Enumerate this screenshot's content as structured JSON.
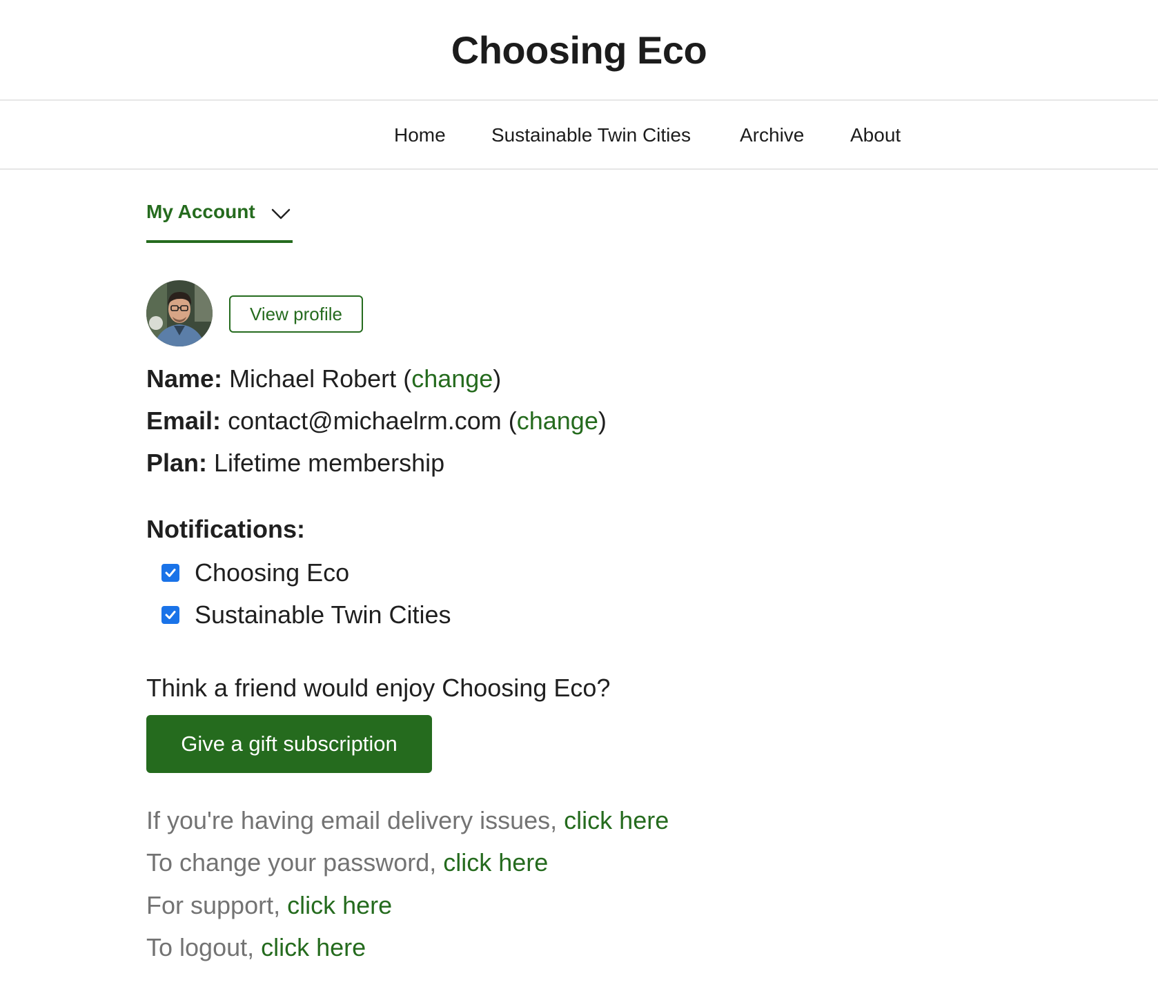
{
  "site": {
    "title": "Choosing Eco"
  },
  "nav": {
    "items": [
      {
        "label": "Home"
      },
      {
        "label": "Sustainable Twin Cities"
      },
      {
        "label": "Archive"
      },
      {
        "label": "About"
      }
    ]
  },
  "account_menu": {
    "label": "My Account",
    "icon": "chevron-down-icon"
  },
  "profile": {
    "avatar": "avatar-photo",
    "view_profile_label": "View profile"
  },
  "account_info": {
    "name_label": "Name:",
    "name_value": "Michael Robert",
    "email_label": "Email:",
    "email_value": "contact@michaelrm.com",
    "change_label": "change",
    "plan_label": "Plan:",
    "plan_value": "Lifetime membership"
  },
  "notifications": {
    "heading": "Notifications:",
    "items": [
      {
        "label": "Choosing Eco",
        "checked": true
      },
      {
        "label": "Sustainable Twin Cities",
        "checked": true
      }
    ]
  },
  "gift": {
    "prompt": "Think a friend would enjoy Choosing Eco?",
    "button_label": "Give a gift subscription"
  },
  "help": {
    "link_label": "click here",
    "lines": [
      {
        "text": "If you're having email delivery issues,"
      },
      {
        "text": "To change your password,"
      },
      {
        "text": "For support,"
      },
      {
        "text": "To logout,"
      }
    ]
  },
  "colors": {
    "accent": "#256b1e",
    "checkbox": "#1a73e8",
    "muted_text": "#737373"
  }
}
